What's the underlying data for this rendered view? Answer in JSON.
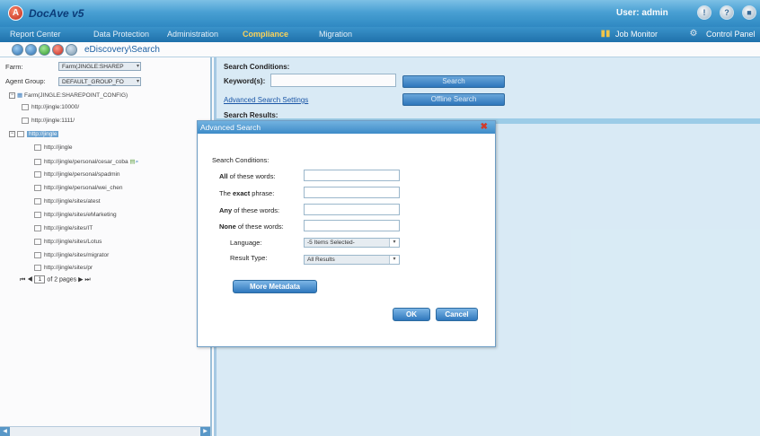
{
  "app": {
    "title": "DocAve v5",
    "logo_letter": "A",
    "user_label": "User: admin"
  },
  "nav": {
    "items": [
      "Report Center",
      "Data Protection",
      "Administration",
      "Compliance",
      "Migration"
    ],
    "active": "Compliance",
    "job_monitor": "Job Monitor",
    "control_panel": "Control Panel"
  },
  "toolbar": {
    "breadcrumb": "eDiscovery\\Search"
  },
  "left": {
    "farm_label": "Farm:",
    "farm_value": "Farm(JINGLE:SHAREP",
    "agent_group_label": "Agent Group:",
    "agent_group_value": "DEFAULT_GROUP_FO",
    "tree_root": "Farm(JINGLE:SHAREPOINT_CONFIG)",
    "tree_items": [
      "http://jingle:10000/",
      "http://jingle:1111/",
      "http://jingle",
      "http://jingle",
      "http://jingle/personal/cesar_coba",
      "http://jingle/personal/spadmin",
      "http://jingle/personal/wei_chen",
      "http://jingle/sites/atest",
      "http://jingle/sites/eMarketing",
      "http://jingle/sites/IT",
      "http://jingle/sites/Lotus",
      "http://jingle/sites/migrator",
      "http://jingle/sites/pr"
    ],
    "pager_page": "1",
    "pager_text": "of 2 pages"
  },
  "main": {
    "search_conditions": "Search Conditions:",
    "keywords_label": "Keyword(s):",
    "search_button": "Search",
    "advanced_link": "Advanced Search Settings",
    "offline_button": "Offline Search",
    "search_results": "Search Results:"
  },
  "dialog": {
    "title": "Advanced Search",
    "section": "Search Conditions:",
    "all_words_bold": "All",
    "all_words_rest": " of these words:",
    "exact_pre": "The ",
    "exact_bold": "exact",
    "exact_rest": " phrase:",
    "any_bold": "Any",
    "any_rest": " of these words:",
    "none_bold": "None",
    "none_rest": " of these words:",
    "language_label": "Language:",
    "language_value": "-5 Items Selected-",
    "result_type_label": "Result Type:",
    "result_type_value": "All Results",
    "more_metadata": "More Metadata",
    "ok": "OK",
    "cancel": "Cancel"
  },
  "colors": {
    "titlebar": "#4aa3d6",
    "nav_active": "#ffd65a",
    "accent": "#2f78bd",
    "close": "#d23a2a"
  }
}
